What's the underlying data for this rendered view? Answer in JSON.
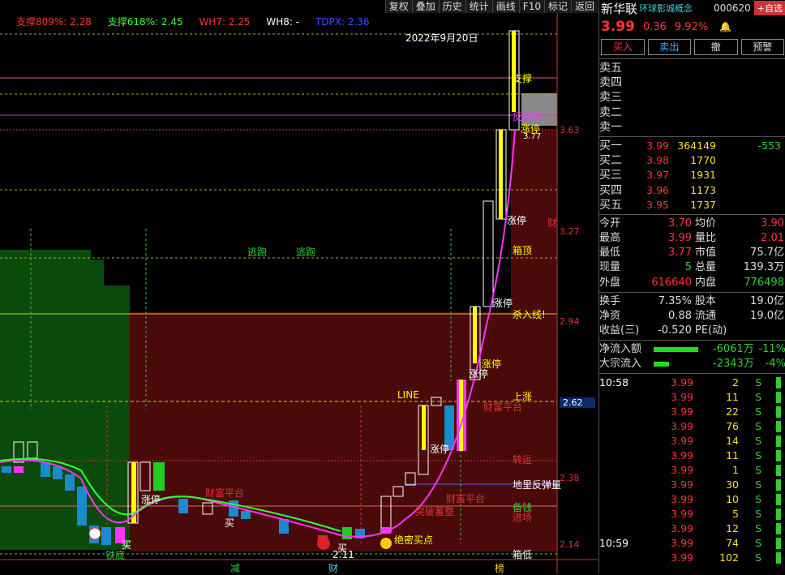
{
  "toolbar": [
    "复权",
    "叠加",
    "历史",
    "统计",
    "画线",
    "F10",
    "标记",
    "返回"
  ],
  "indicators": [
    {
      "label": "支撑809%: 2.28",
      "color": "#ff3333"
    },
    {
      "label": "支撑618%: 2.45",
      "color": "#33ff33"
    },
    {
      "label": "WH7: 2.25",
      "color": "#ff3333"
    },
    {
      "label": "WH8: -",
      "color": "#ffffff"
    },
    {
      "label": "TDPX: 2.36",
      "color": "#3355ff"
    }
  ],
  "chart": {
    "date_label": "2022年9月20日",
    "price_levels": [
      "3.63",
      "3.27",
      "2.94",
      "2.62",
      "2.38",
      "2.14"
    ],
    "current_level": "2.62",
    "annotations": {
      "zhicheng": "支撑",
      "fanzhuan": "反转价",
      "zhangting": "涨停",
      "caifu": "财富平台",
      "shajiang": "杀入线!",
      "xiangding": "箱顶",
      "shangzhang": "上涨",
      "zhuanyun": "转运",
      "diliwei": "地里反弹量",
      "beiqian": "备钱",
      "jinchang": "进场",
      "xiangdi": "箱低",
      "taopao": "逃跑",
      "tiedi": "铁底",
      "line": "LINE",
      "tupo": "突破蓄整",
      "juemi": "绝密买点",
      "mai": "买",
      "low_val": "2.11",
      "cai": "财",
      "top_val": "3.77"
    },
    "x_labels": [
      "减",
      "财",
      "榜"
    ]
  },
  "panel": {
    "name": "新华联",
    "concept": "环球影城概念",
    "code": "000620",
    "add": "+自选",
    "price": "3.99",
    "change": "0.36",
    "pct": "9.92%",
    "buttons": [
      "买入",
      "卖出",
      "撤",
      "预警"
    ],
    "sells": [
      "卖五",
      "卖四",
      "卖三",
      "卖二",
      "卖一"
    ],
    "buys": [
      {
        "l": "买一",
        "p": "3.99",
        "q": "364149",
        "c": "-553"
      },
      {
        "l": "买二",
        "p": "3.98",
        "q": "1770",
        "c": ""
      },
      {
        "l": "买三",
        "p": "3.97",
        "q": "1931",
        "c": ""
      },
      {
        "l": "买四",
        "p": "3.96",
        "q": "1173",
        "c": ""
      },
      {
        "l": "买五",
        "p": "3.95",
        "q": "1737",
        "c": ""
      }
    ],
    "stats": [
      {
        "k": "今开",
        "a": "3.70",
        "k2": "均价",
        "b": "3.90"
      },
      {
        "k": "最高",
        "a": "3.99",
        "k2": "量比",
        "b": "2.01"
      },
      {
        "k": "最低",
        "a": "3.77",
        "k2": "市值",
        "b": "75.7亿"
      },
      {
        "k": "现量",
        "a": "5",
        "k2": "总量",
        "b": "139.3万"
      },
      {
        "k": "外盘",
        "a": "616640",
        "k2": "内盘",
        "b": "776498"
      }
    ],
    "stats2": [
      {
        "k": "换手",
        "a": "7.35%",
        "k2": "股本",
        "b": "19.0亿"
      },
      {
        "k": "净资",
        "a": "0.88",
        "k2": "流通",
        "b": "19.0亿"
      },
      {
        "k": "收益(三)",
        "a": "-0.520",
        "k2": "PE(动)",
        "b": ""
      }
    ],
    "flows": [
      {
        "k": "净流入额",
        "a": "-6061万",
        "pc": "-11%",
        "w": 56
      },
      {
        "k": "大宗流入",
        "a": "-2343万",
        "pc": "-4%",
        "w": 20
      }
    ],
    "ticks": [
      {
        "t": "10:58",
        "p": "3.99",
        "v": "2",
        "s": "S"
      },
      {
        "t": "",
        "p": "3.99",
        "v": "11",
        "s": "S"
      },
      {
        "t": "",
        "p": "3.99",
        "v": "22",
        "s": "S"
      },
      {
        "t": "",
        "p": "3.99",
        "v": "76",
        "s": "S"
      },
      {
        "t": "",
        "p": "3.99",
        "v": "14",
        "s": "S"
      },
      {
        "t": "",
        "p": "3.99",
        "v": "11",
        "s": "S"
      },
      {
        "t": "",
        "p": "3.99",
        "v": "1",
        "s": "S"
      },
      {
        "t": "",
        "p": "3.99",
        "v": "30",
        "s": "S"
      },
      {
        "t": "",
        "p": "3.99",
        "v": "10",
        "s": "S"
      },
      {
        "t": "",
        "p": "3.99",
        "v": "5",
        "s": "S"
      },
      {
        "t": "",
        "p": "3.99",
        "v": "12",
        "s": "S"
      },
      {
        "t": "10:59",
        "p": "3.99",
        "v": "74",
        "s": "S"
      },
      {
        "t": "",
        "p": "3.99",
        "v": "102",
        "s": "S"
      }
    ]
  }
}
